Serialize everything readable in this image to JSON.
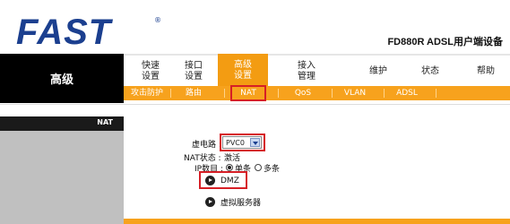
{
  "brand": {
    "logo": "FAST",
    "reg_mark": "®",
    "model": "FD880R ADSL用户端设备"
  },
  "side": {
    "title": "高级",
    "section_label": "NAT"
  },
  "nav": {
    "items": [
      {
        "label": "快速\n设置"
      },
      {
        "label": "接口\n设置"
      },
      {
        "label": "高级\n设置"
      },
      {
        "label": "接入\n管理"
      },
      {
        "label": "维护"
      },
      {
        "label": "状态"
      },
      {
        "label": "帮助"
      }
    ],
    "active_index": 2
  },
  "subnav": {
    "items": [
      {
        "label": "攻击防护"
      },
      {
        "label": "路由"
      },
      {
        "label": "NAT"
      },
      {
        "label": "QoS"
      },
      {
        "label": "VLAN"
      },
      {
        "label": "ADSL"
      }
    ],
    "active_index": 2
  },
  "form": {
    "pvc_label": "虚电路 :",
    "pvc_value": "PVC0",
    "nat_status_label": "NAT状态 :",
    "nat_status_value": "激活",
    "ip_count_label": "IP数目 :",
    "ip_single": "单条",
    "ip_multi": "多条",
    "dmz_link": "DMZ",
    "virtual_server_link": "虚拟服务器"
  },
  "colors": {
    "accent": "#f7a21d",
    "brand_blue": "#1b3f8f",
    "highlight_red": "#d61f26"
  }
}
